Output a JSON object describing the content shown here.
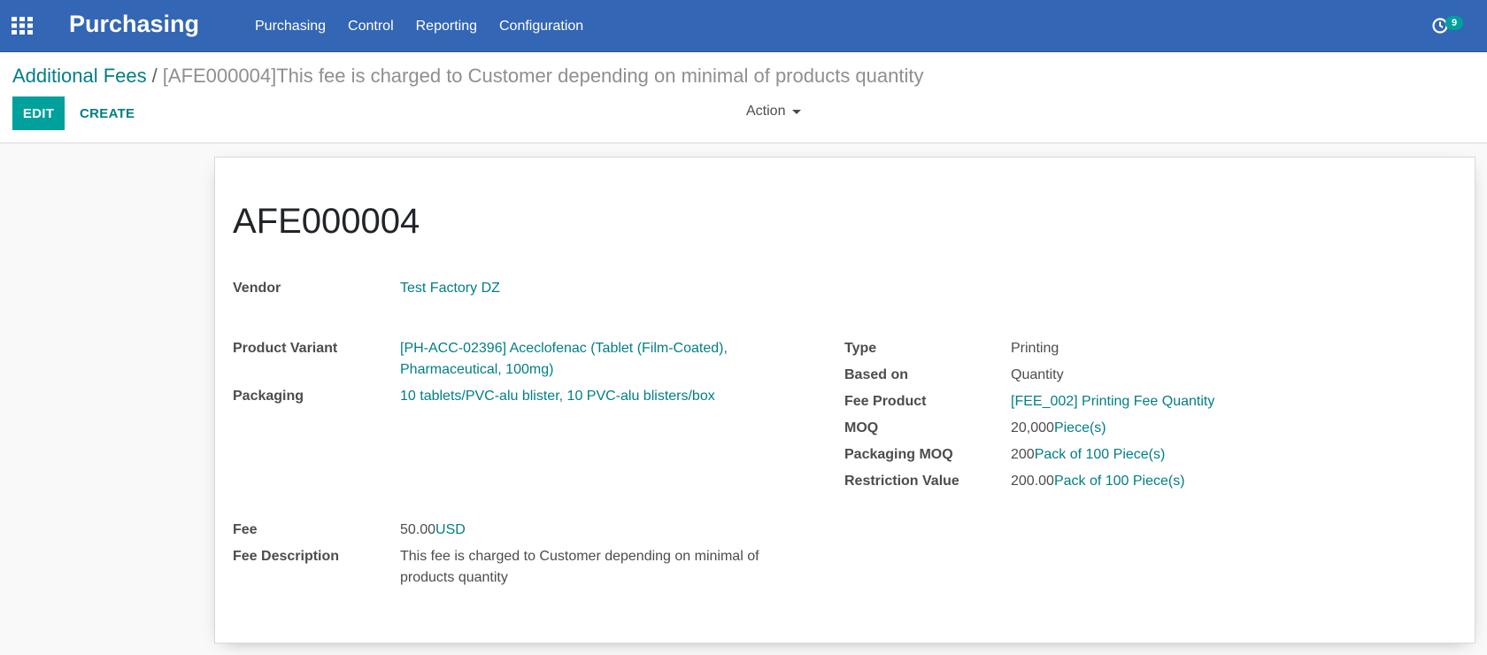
{
  "navbar": {
    "brand": "Purchasing",
    "menu": [
      "Purchasing",
      "Control",
      "Reporting",
      "Configuration"
    ],
    "activity_count": "9",
    "color": "#3366b4"
  },
  "breadcrumb": {
    "parent": "Additional Fees",
    "separator": "/",
    "current": "[AFE000004]This fee is charged to Customer depending on minimal of products quantity"
  },
  "buttons": {
    "edit": "EDIT",
    "create": "CREATE",
    "action": "Action"
  },
  "record": {
    "name": "AFE000004",
    "vendor_label": "Vendor",
    "vendor": "Test Factory DZ",
    "product_variant_label": "Product Variant",
    "product_variant_line1": "[PH-ACC-02396] Aceclofenac (Tablet (Film-Coated),",
    "product_variant_line2": "Pharmaceutical, 100mg)",
    "packaging_label": "Packaging",
    "packaging": "10 tablets/PVC-alu blister, 10 PVC-alu blisters/box",
    "type_label": "Type",
    "type": "Printing",
    "based_on_label": "Based on",
    "based_on": "Quantity",
    "fee_product_label": "Fee Product",
    "fee_product": "[FEE_002] Printing Fee Quantity",
    "moq_label": "MOQ",
    "moq_value": "20,000",
    "moq_uom": "Piece(s)",
    "packaging_moq_label": "Packaging MOQ",
    "packaging_moq_value": "200",
    "packaging_moq_uom": "Pack of 100 Piece(s)",
    "restriction_value_label": "Restriction Value",
    "restriction_value": "200.00",
    "restriction_uom": "Pack of 100 Piece(s)",
    "fee_label": "Fee",
    "fee_value": "50.00",
    "fee_currency": "USD",
    "fee_description_label": "Fee Description",
    "fee_description_line1": "This fee is charged to Customer depending on minimal of",
    "fee_description_line2": "products quantity"
  },
  "colors": {
    "accent": "#00a09d",
    "link": "#017e84"
  }
}
